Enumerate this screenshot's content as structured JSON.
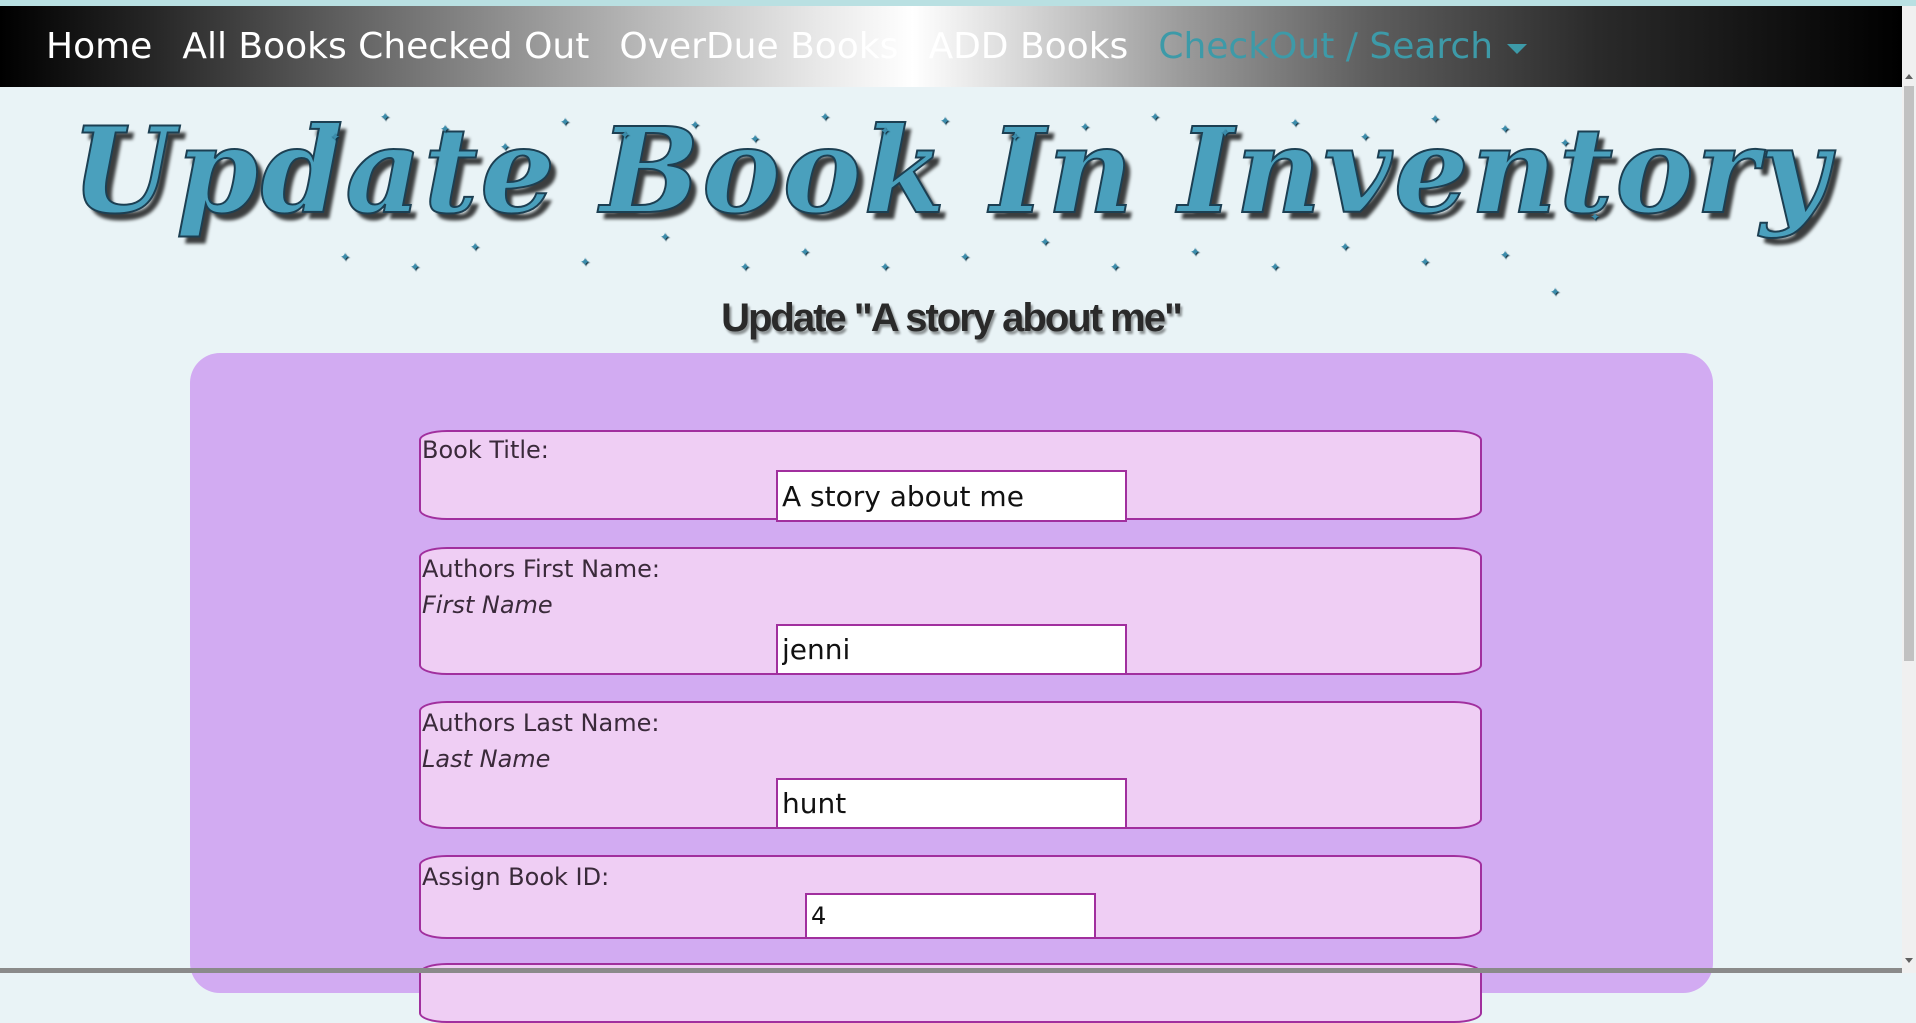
{
  "nav": {
    "items": [
      {
        "label": "Home"
      },
      {
        "label": "All Books Checked Out"
      },
      {
        "label": "OverDue Books"
      },
      {
        "label": "ADD Books"
      }
    ],
    "dropdown": {
      "label": "CheckOut / Search"
    }
  },
  "page": {
    "title": "Update Book In Inventory",
    "subtitle": "Update \"A story about me\""
  },
  "form": {
    "book_title": {
      "label": "Book Title:",
      "value": "A story about me"
    },
    "author_first": {
      "label": "Authors First Name:",
      "hint": "First Name",
      "value": "jenni"
    },
    "author_last": {
      "label": "Authors Last Name:",
      "hint": "Last Name",
      "value": "hunt"
    },
    "book_id": {
      "label": "Assign Book ID:",
      "value": "4"
    }
  },
  "colors": {
    "accent": "#3d9aa8",
    "card": "#d2abf2",
    "field_bg": "#efcef4",
    "field_border": "#a12f9e",
    "title": "#4aa0bd"
  }
}
